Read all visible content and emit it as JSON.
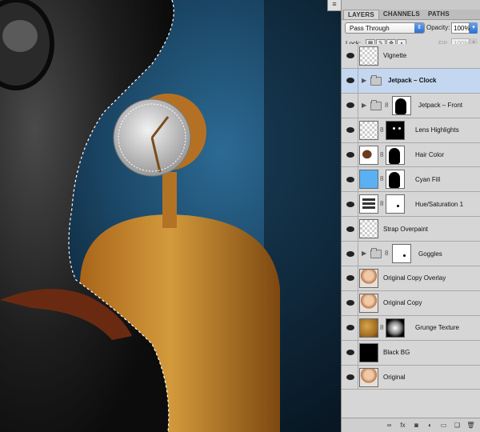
{
  "panel": {
    "tabs": [
      "LAYERS",
      "CHANNELS",
      "PATHS"
    ],
    "blend_mode": "Pass Through",
    "opacity_label": "Opacity:",
    "opacity_value": "100%",
    "lock_label": "Lock:",
    "fill_label": "Fill:",
    "fill_value": "100%"
  },
  "layers": [
    {
      "name": "Vignette",
      "type": "layer",
      "thumb": "checker",
      "selected": false
    },
    {
      "name": "Jetpack – Clock",
      "type": "group",
      "selected": true
    },
    {
      "name": "Jetpack – Front",
      "type": "group",
      "mask": "silhouette",
      "selected": false
    },
    {
      "name": "Lens Highlights",
      "type": "layer",
      "thumb": "checker",
      "mask": "black-dots",
      "selected": false
    },
    {
      "name": "Hair Color",
      "type": "layer",
      "thumb": "hair",
      "mask": "silhouette",
      "selected": false
    },
    {
      "name": "Cyan Fill",
      "type": "layer",
      "thumb": "cyan",
      "mask": "silhouette",
      "selected": false
    },
    {
      "name": "Hue/Saturation 1",
      "type": "adjustment",
      "thumb": "adjust",
      "mask": "speck",
      "selected": false
    },
    {
      "name": "Strap Overpaint",
      "type": "layer",
      "thumb": "checker",
      "selected": false
    },
    {
      "name": "Goggles",
      "type": "group",
      "mask": "speck",
      "selected": false
    },
    {
      "name": "Original Copy Overlay",
      "type": "layer",
      "thumb": "portrait",
      "selected": false
    },
    {
      "name": "Original Copy",
      "type": "layer",
      "thumb": "portrait",
      "selected": false
    },
    {
      "name": "Grunge Texture",
      "type": "layer",
      "thumb": "grunge",
      "mask": "gradient",
      "selected": false
    },
    {
      "name": "Black BG",
      "type": "layer",
      "thumb": "black",
      "selected": false
    },
    {
      "name": "Original",
      "type": "layer",
      "thumb": "portrait",
      "selected": false
    }
  ],
  "bottom_icons": [
    "link-icon",
    "fx-icon",
    "mask-icon",
    "adjustment-icon",
    "folder-icon",
    "new-layer-icon",
    "trash-icon"
  ],
  "colors": {
    "background_blue": "#1f4a6e",
    "jetpack_orange": "#c9812a",
    "selection_highlight": "#c4d7f0",
    "cyan_fill": "#5ab0f2"
  }
}
